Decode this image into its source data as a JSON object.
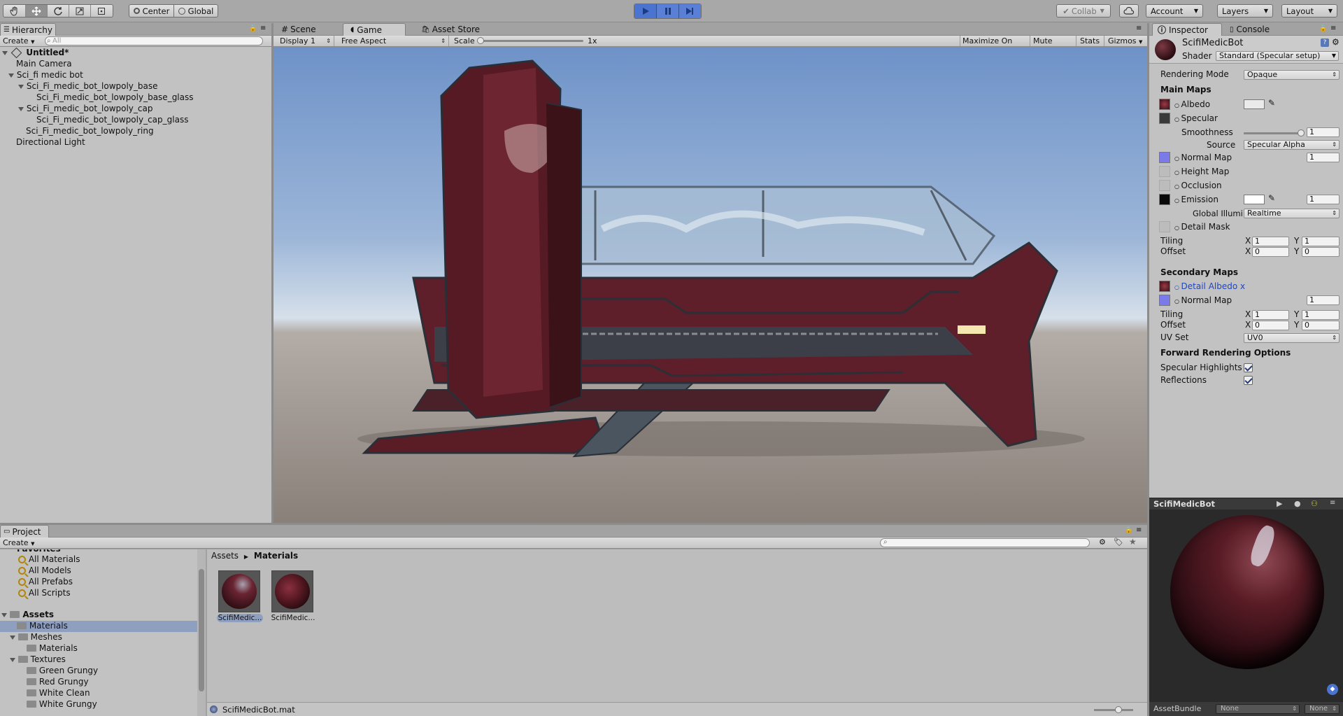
{
  "toolbar": {
    "pivot_center": "Center",
    "pivot_global": "Global",
    "collab": "Collab",
    "account": "Account",
    "layers": "Layers",
    "layout": "Layout"
  },
  "hierarchy": {
    "tab": "Hierarchy",
    "create": "Create",
    "search_placeholder": "All",
    "scene_name": "Untitled*",
    "items": [
      "Main Camera",
      "Sci_fi medic bot",
      "Sci_Fi_medic_bot_lowpoly_base",
      "Sci_Fi_medic_bot_lowpoly_base_glass",
      "Sci_Fi_medic_bot_lowpoly_cap",
      "Sci_Fi_medic_bot_lowpoly_cap_glass",
      "Sci_Fi_medic_bot_lowpoly_ring",
      "Directional Light"
    ]
  },
  "center": {
    "tab_scene": "Scene",
    "tab_game": "Game",
    "tab_asset_store": "Asset Store",
    "display": "Display 1",
    "aspect": "Free Aspect",
    "scale_label": "Scale",
    "scale_value": "1x",
    "maximize": "Maximize On Play",
    "mute": "Mute Audio",
    "stats": "Stats",
    "gizmos": "Gizmos"
  },
  "inspector": {
    "tab_inspector": "Inspector",
    "tab_console": "Console",
    "material_name": "ScifiMedicBot",
    "shader_label": "Shader",
    "shader_value": "Standard (Specular setup)",
    "rendering_mode_label": "Rendering Mode",
    "rendering_mode_value": "Opaque",
    "main_maps": "Main Maps",
    "albedo": "Albedo",
    "specular": "Specular",
    "smoothness": "Smoothness",
    "smoothness_value": "1",
    "source": "Source",
    "source_value": "Specular Alpha",
    "normal_map": "Normal Map",
    "normal_value": "1",
    "height_map": "Height Map",
    "occlusion": "Occlusion",
    "emission": "Emission",
    "emission_value": "1",
    "global_illum": "Global Illumi",
    "global_illum_value": "Realtime",
    "detail_mask": "Detail Mask",
    "tiling": "Tiling",
    "offset": "Offset",
    "x": "X",
    "y": "Y",
    "tiling_x": "1",
    "tiling_y": "1",
    "offset_x": "0",
    "offset_y": "0",
    "secondary_maps": "Secondary Maps",
    "detail_albedo": "Detail Albedo x",
    "normal_map2": "Normal Map",
    "normal2_value": "1",
    "tiling2_x": "1",
    "tiling2_y": "1",
    "offset2_x": "0",
    "offset2_y": "0",
    "uv_set": "UV Set",
    "uv_set_value": "UV0",
    "forward_options": "Forward Rendering Options",
    "specular_highlights": "Specular Highlights",
    "reflections": "Reflections",
    "preview_title": "ScifiMedicBot",
    "assetbundle_label": "AssetBundle",
    "assetbundle_value": "None",
    "assetbundle_variant": "None"
  },
  "project": {
    "tab": "Project",
    "create": "Create",
    "favorites_header": "Favorites",
    "favorites": [
      "All Materials",
      "All Models",
      "All Prefabs",
      "All Scripts"
    ],
    "assets": "Assets",
    "tree": [
      {
        "label": "Materials",
        "depth": 1,
        "selected": true
      },
      {
        "label": "Meshes",
        "depth": 1,
        "selected": false
      },
      {
        "label": "Materials",
        "depth": 2,
        "selected": false
      },
      {
        "label": "Textures",
        "depth": 1,
        "selected": false
      },
      {
        "label": "Green Grungy",
        "depth": 2,
        "selected": false
      },
      {
        "label": "Red Grungy",
        "depth": 2,
        "selected": false
      },
      {
        "label": "White Clean",
        "depth": 2,
        "selected": false
      },
      {
        "label": "White Grungy",
        "depth": 2,
        "selected": false
      }
    ],
    "breadcrumb_root": "Assets",
    "breadcrumb_current": "Materials",
    "grid_items": [
      "ScifiMedic...",
      "ScifiMedic..."
    ],
    "footer_file": "ScifiMedicBot.mat"
  },
  "colors": {
    "accent_blue": "#4a74d0",
    "selection": "#8f9fc0",
    "material_red": "#6a1c25",
    "normal_map": "#7a7ae8"
  }
}
